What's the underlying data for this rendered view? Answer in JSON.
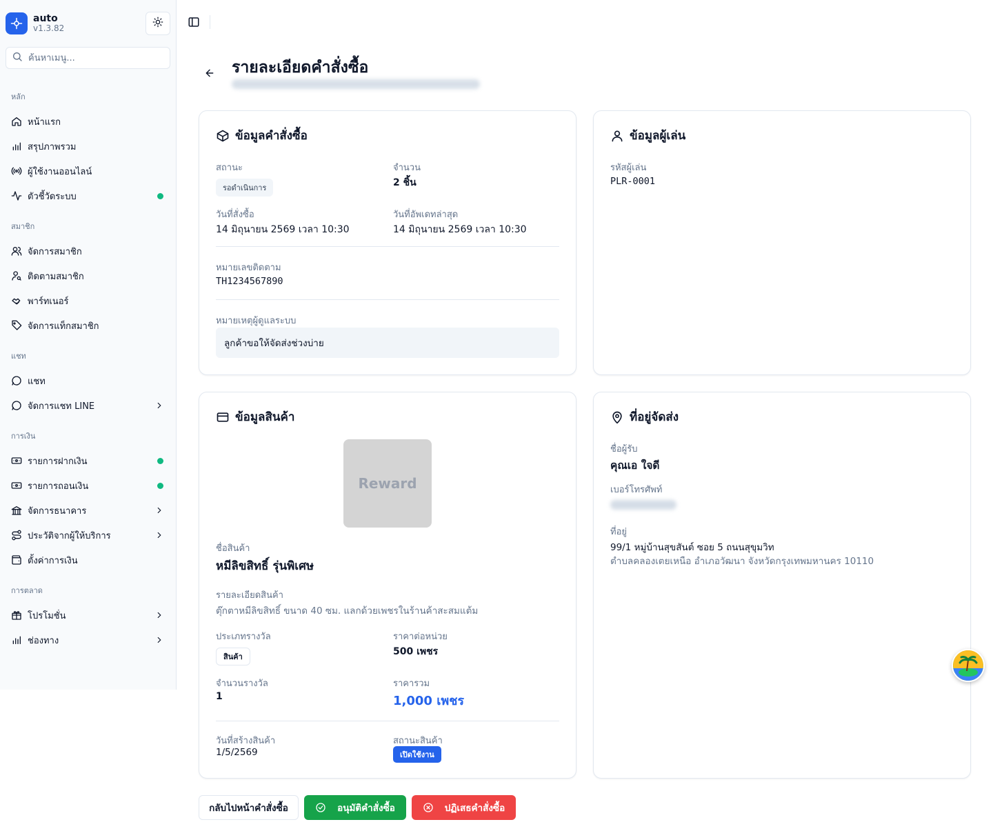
{
  "app": {
    "name": "auto",
    "version": "v1.3.82"
  },
  "search": {
    "placeholder": "ค้นหาเมนู..."
  },
  "sidebar": {
    "groups": [
      {
        "label": "หลัก",
        "items": [
          {
            "label": "หน้าแรก",
            "icon": "home-icon"
          },
          {
            "label": "สรุปภาพรวม",
            "icon": "bar-chart-icon"
          },
          {
            "label": "ผู้ใช้งานออนไลน์",
            "icon": "radio-icon"
          },
          {
            "label": "ตัวชี้วัดระบบ",
            "icon": "activity-icon",
            "dot": true
          }
        ]
      },
      {
        "label": "สมาชิก",
        "items": [
          {
            "label": "จัดการสมาชิก",
            "icon": "users-icon"
          },
          {
            "label": "ติดตามสมาชิก",
            "icon": "user-search-icon"
          },
          {
            "label": "พาร์ทเนอร์",
            "icon": "handshake-icon"
          },
          {
            "label": "จัดการแท็กสมาชิก",
            "icon": "tag-icon"
          }
        ]
      },
      {
        "label": "แชท",
        "items": [
          {
            "label": "แชท",
            "icon": "message-circle-icon"
          },
          {
            "label": "จัดการแชท LINE",
            "icon": "message-circle-icon",
            "chevron": true
          }
        ]
      },
      {
        "label": "การเงิน",
        "items": [
          {
            "label": "รายการฝากเงิน",
            "icon": "deposit-icon",
            "dot": true
          },
          {
            "label": "รายการถอนเงิน",
            "icon": "withdraw-icon",
            "dot": true
          },
          {
            "label": "จัดการธนาคาร",
            "icon": "bank-icon",
            "chevron": true
          },
          {
            "label": "ประวัติจากผู้ให้บริการ",
            "icon": "route-icon",
            "chevron": true
          },
          {
            "label": "ตั้งค่าการเงิน",
            "icon": "wallet-icon"
          }
        ]
      },
      {
        "label": "การตลาด",
        "items": [
          {
            "label": "โปรโมชั่น",
            "icon": "gift-icon",
            "chevron": true
          },
          {
            "label": "ช่องทาง",
            "icon": "bar-chart-icon",
            "chevron": true
          }
        ]
      }
    ]
  },
  "page": {
    "title": "รายละเอียดคำสั่งซื้อ"
  },
  "order_card": {
    "title": "ข้อมูลคำสั่งซื้อ",
    "status_label": "สถานะ",
    "status_value": "รอดำเนินการ",
    "qty_label": "จำนวน",
    "qty_value": "2 ชิ้น",
    "order_date_label": "วันที่สั่งซื้อ",
    "order_date_value": "14 มิถุนายน 2569 เวลา 10:30",
    "updated_label": "วันที่อัพเดทล่าสุด",
    "updated_value": "14 มิถุนายน 2569 เวลา 10:30",
    "tracking_label": "หมายเลขติดตาม",
    "tracking_value": "TH1234567890",
    "note_label": "หมายเหตุผู้ดูแลระบบ",
    "note_value": "ลูกค้าขอให้จัดส่งช่วงบ่าย"
  },
  "player_card": {
    "title": "ข้อมูลผู้เล่น",
    "player_id_label": "รหัสผู้เล่น",
    "player_id_value": "PLR-0001"
  },
  "product_card": {
    "title": "ข้อมูลสินค้า",
    "image_text": "Reward",
    "name_label": "ชื่อสินค้า",
    "name_value": "หมีลิขสิทธิ์ รุ่นพิเศษ",
    "desc_label": "รายละเอียดสินค้า",
    "desc_value": "ตุ๊กตาหมีลิขสิทธิ์ ขนาด 40 ซม. แลกด้วยเพชรในร้านค้าสะสมแต้ม",
    "type_label": "ประเภทรางวัล",
    "type_value": "สินค้า",
    "unit_price_label": "ราคาต่อหน่วย",
    "unit_price_value": "500 เพชร",
    "reward_qty_label": "จำนวนรางวัล",
    "reward_qty_value": "1",
    "total_label": "ราคารวม",
    "total_value": "1,000 เพชร",
    "created_label": "วันที่สร้างสินค้า",
    "created_value": "1/5/2569",
    "product_status_label": "สถานะสินค้า",
    "product_status_value": "เปิดใช้งาน"
  },
  "address_card": {
    "title": "ที่อยู่จัดส่ง",
    "recipient_label": "ชื่อผู้รับ",
    "recipient_value": "คุณเอ ใจดี",
    "phone_label": "เบอร์โทรศัพท์",
    "address_label": "ที่อยู่",
    "address_line1": "99/1 หมู่บ้านสุขสันต์ ซอย 5 ถนนสุขุมวิท",
    "address_line2": "ตำบลคลองเตยเหนือ อำเภอวัฒนา จังหวัดกรุงเทพมหานคร 10110"
  },
  "actions": {
    "back_label": "กลับไปหน้าคำสั่งซื้อ",
    "approve_label": "อนุมัติคำสั่งซื้อ",
    "reject_label": "ปฏิเสธคำสั่งซื้อ"
  },
  "colors": {
    "primary": "#2563eb",
    "success": "#16a34a",
    "danger": "#ef4444",
    "online_dot": "#10b981"
  }
}
